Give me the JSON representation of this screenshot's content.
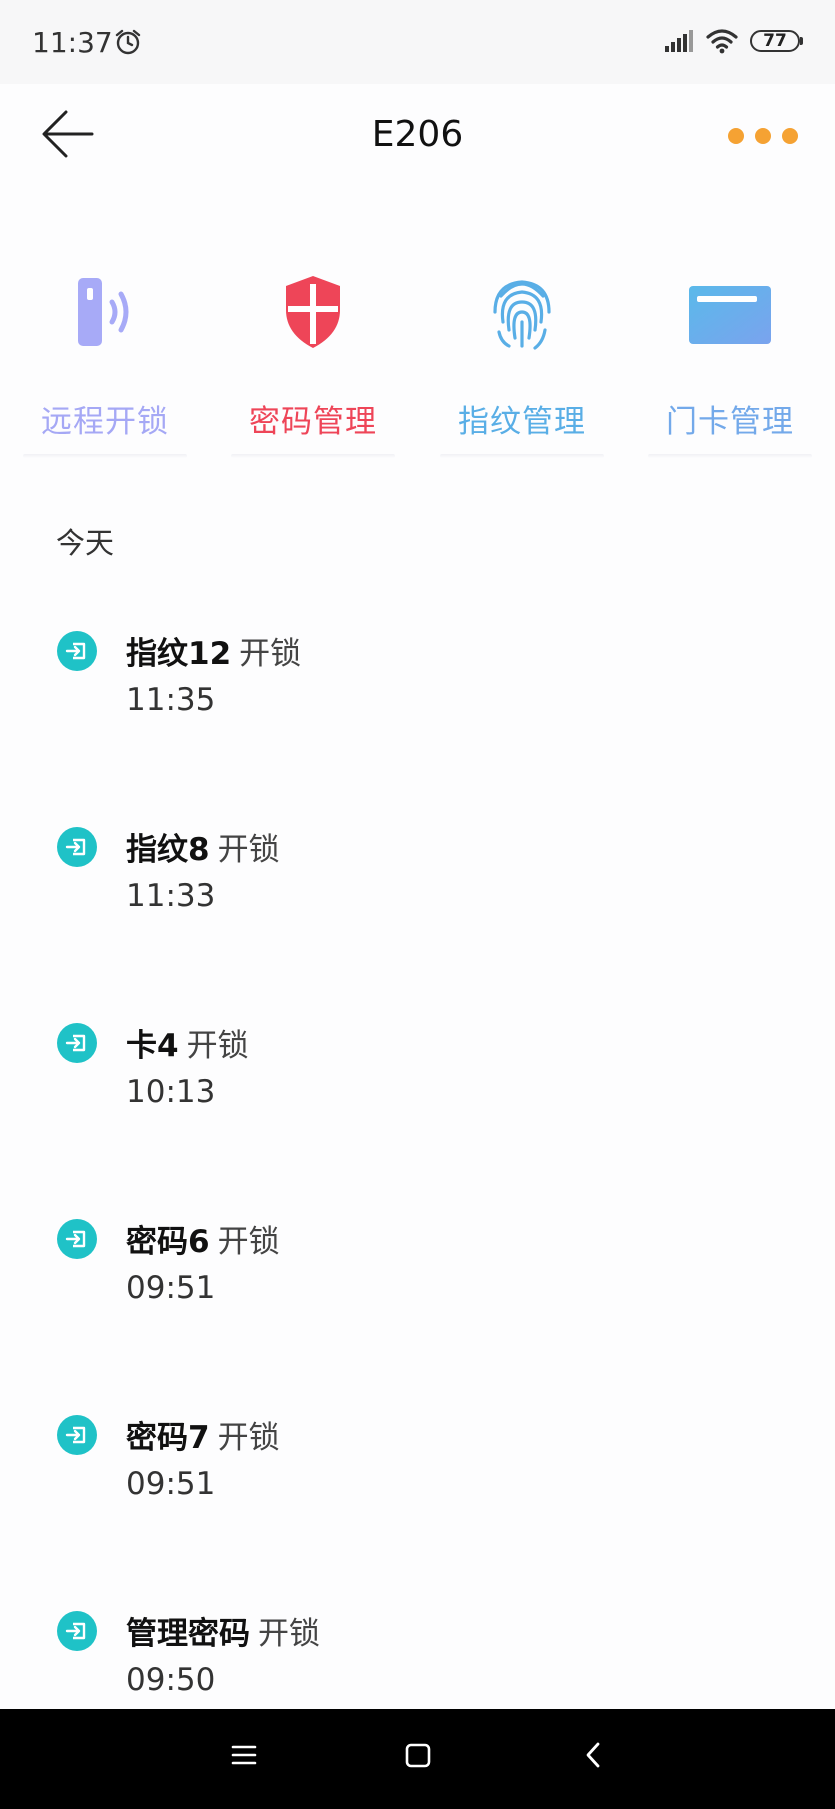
{
  "status_bar": {
    "time": "11:37",
    "battery": "77",
    "icons": [
      "alarm-icon",
      "signal-icon",
      "wifi-icon",
      "battery-icon"
    ]
  },
  "header": {
    "title": "E206",
    "back_icon": "back-arrow-icon",
    "more_icon": "more-dots-icon",
    "accent": "#f5a233"
  },
  "actions": [
    {
      "label": "远程开锁",
      "icon": "remote-unlock-icon",
      "color": "#a5a8f5"
    },
    {
      "label": "密码管理",
      "icon": "shield-icon",
      "color": "#ee4558"
    },
    {
      "label": "指纹管理",
      "icon": "fingerprint-icon",
      "color": "#59aee6"
    },
    {
      "label": "门卡管理",
      "icon": "card-icon",
      "color": "#73a9ea"
    }
  ],
  "section": {
    "title": "今天"
  },
  "logs": [
    {
      "name": "指纹12",
      "action": "开锁",
      "time": "11:35"
    },
    {
      "name": "指纹8",
      "action": "开锁",
      "time": "11:33"
    },
    {
      "name": "卡4",
      "action": "开锁",
      "time": "10:13"
    },
    {
      "name": "密码6",
      "action": "开锁",
      "time": "09:51"
    },
    {
      "name": "密码7",
      "action": "开锁",
      "time": "09:51"
    },
    {
      "name": "管理密码",
      "action": "开锁",
      "time": "09:50"
    }
  ],
  "log_icon": {
    "name": "enter-icon",
    "color": "#1fc2c7"
  },
  "nav_bar": {
    "icons": [
      "menu-icon",
      "home-square-icon",
      "back-chevron-icon"
    ]
  }
}
